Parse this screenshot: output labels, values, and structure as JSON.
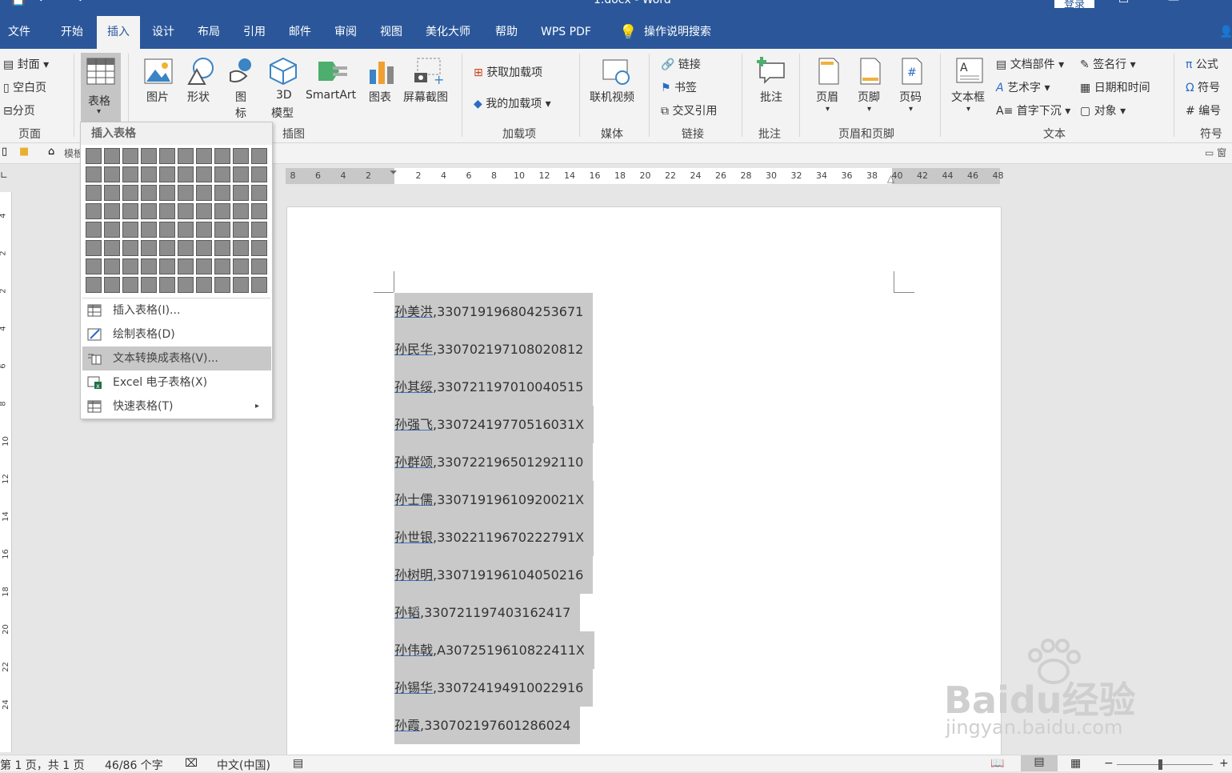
{
  "window": {
    "title": "1.docx - Word",
    "login": "登录"
  },
  "tabs": [
    "文件",
    "开始",
    "插入",
    "设计",
    "布局",
    "引用",
    "邮件",
    "审阅",
    "视图",
    "美化大师",
    "帮助",
    "WPS PDF"
  ],
  "active_tab": "插入",
  "tell_me": "操作说明搜索",
  "ribbon": {
    "page": {
      "cover": "封面",
      "blank": "空白页",
      "break": "分页",
      "label": "页面"
    },
    "table": {
      "label": "表格"
    },
    "illustrations": {
      "picture": "图片",
      "shapes": "形状",
      "icons_1": "图",
      "icons_2": "标",
      "model_1": "3D",
      "model_2": "模型",
      "smartart": "SmartArt",
      "chart": "图表",
      "screenshot": "屏幕截图",
      "label": "插图"
    },
    "addins": {
      "get": "获取加载项",
      "mine": "我的加载项",
      "label": "加载项"
    },
    "media": {
      "video": "联机视频",
      "label": "媒体"
    },
    "links": {
      "link": "链接",
      "bookmark": "书签",
      "crossref": "交叉引用",
      "label": "链接"
    },
    "comments": {
      "comment": "批注",
      "label": "批注"
    },
    "header_footer": {
      "header": "页眉",
      "footer": "页脚",
      "page_number": "页码",
      "label": "页眉和页脚"
    },
    "text": {
      "textbox": "文本框",
      "quick_parts": "文档部件",
      "wordart": "艺术字",
      "dropcap": "首字下沉",
      "signature": "签名行",
      "datetime": "日期和时间",
      "object": "对象",
      "label": "文本"
    },
    "symbols": {
      "equation": "公式",
      "symbol": "符号",
      "number": "编号",
      "label": "符号"
    }
  },
  "nav": {
    "template": "模板"
  },
  "ruler": {
    "h_left": [
      "8",
      "6",
      "4",
      "2"
    ],
    "h_right": [
      "2",
      "4",
      "6",
      "8",
      "10",
      "12",
      "14",
      "16",
      "18",
      "20",
      "22",
      "24",
      "26",
      "28",
      "30",
      "32",
      "34",
      "36",
      "38",
      "40",
      "42",
      "44",
      "46",
      "48"
    ],
    "v": [
      "4",
      "2",
      "2",
      "4",
      "6",
      "8",
      "10",
      "12",
      "14",
      "16",
      "18",
      "20",
      "22",
      "24"
    ]
  },
  "table_menu": {
    "title": "插入表格",
    "grid_cols": 10,
    "grid_rows": 8,
    "items": [
      {
        "label": "插入表格(I)...",
        "highlighted": false
      },
      {
        "label": "绘制表格(D)",
        "highlighted": false
      },
      {
        "label": "文本转换成表格(V)...",
        "highlighted": true
      },
      {
        "label": "Excel 电子表格(X)",
        "highlighted": false
      },
      {
        "label": "快速表格(T)",
        "highlighted": false,
        "submenu": true
      }
    ]
  },
  "document": {
    "lines": [
      {
        "name": "孙美洪",
        "id": ",330719196804253671"
      },
      {
        "name": "孙民华",
        "id": ",330702197108020812"
      },
      {
        "name": "孙其绥",
        "id": ",330721197010040515"
      },
      {
        "name": "孙强飞",
        "id": ",33072419770516031X"
      },
      {
        "name": "孙群颂",
        "id": ",330722196501292110"
      },
      {
        "name": "孙士儒",
        "id": ",33071919610920021X"
      },
      {
        "name": "孙世银",
        "id": ",33022119670222791X"
      },
      {
        "name": "孙树明",
        "id": ",330719196104050216"
      },
      {
        "name": "孙韬",
        "id": ",330721197403162417"
      },
      {
        "name": "孙伟戟",
        "id": ",A3072519610822411X"
      },
      {
        "name": "孙锡华",
        "id": ",330724194910022916"
      },
      {
        "name": "孙霞",
        "id": ",330702197601286024"
      }
    ]
  },
  "status": {
    "page": "第 1 页，共 1 页",
    "words": "46/86 个字",
    "lang": "中文(中国)"
  },
  "watermark": {
    "brand": "Baidu经验",
    "url": "jingyan.baidu.com"
  }
}
